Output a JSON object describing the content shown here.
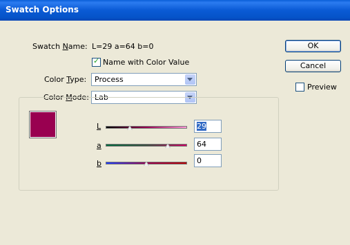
{
  "window": {
    "title": "Swatch Options"
  },
  "swatch_name": {
    "label_pre": "Swatch ",
    "label_u": "N",
    "label_post": "ame:",
    "value": "L=29 a=64 b=0"
  },
  "name_with_color_value": {
    "label": "Name with Color Value",
    "checked": true
  },
  "color_type": {
    "label_pre": "Color ",
    "label_u": "T",
    "label_post": "ype:",
    "value": "Process"
  },
  "color_mode": {
    "label_pre": "Color ",
    "label_u": "M",
    "label_post": "ode:",
    "value": "Lab"
  },
  "swatch_color": "#990050",
  "sliders": [
    {
      "label": "L",
      "value": "29"
    },
    {
      "label": "a",
      "value": "64"
    },
    {
      "label": "b",
      "value": "0"
    }
  ],
  "buttons": {
    "ok": "OK",
    "cancel": "Cancel"
  },
  "preview": {
    "label": "Preview",
    "checked": false
  }
}
